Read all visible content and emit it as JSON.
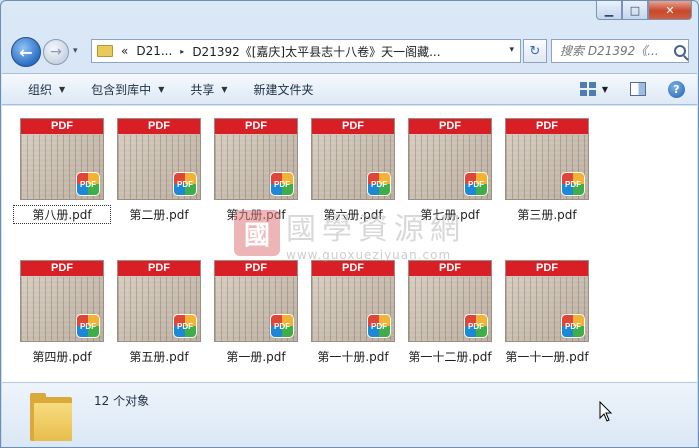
{
  "window": {
    "caption": {
      "minimize": "▁",
      "maximize": "□",
      "close": "✕"
    }
  },
  "nav": {
    "back_glyph": "←",
    "forward_glyph": "→",
    "dropdown_glyph": "▾"
  },
  "address": {
    "overflow": "«",
    "crumbs": [
      "D21...",
      "D21392《[嘉庆]太平县志十八卷》天一阁藏..."
    ],
    "separator": "▸",
    "dropdown_glyph": "▾",
    "refresh_glyph": "↻"
  },
  "search": {
    "placeholder": "搜索 D21392《..."
  },
  "toolbar": {
    "organize": "组织",
    "include_library": "包含到库中",
    "share": "共享",
    "new_folder": "新建文件夹",
    "arrow": "▼"
  },
  "files": [
    {
      "name": "第八册.pdf",
      "selected": true
    },
    {
      "name": "第二册.pdf"
    },
    {
      "name": "第九册.pdf"
    },
    {
      "name": "第六册.pdf"
    },
    {
      "name": "第七册.pdf"
    },
    {
      "name": "第三册.pdf"
    },
    {
      "name": "第四册.pdf"
    },
    {
      "name": "第五册.pdf"
    },
    {
      "name": "第一册.pdf"
    },
    {
      "name": "第一十册.pdf"
    },
    {
      "name": "第一十二册.pdf"
    },
    {
      "name": "第一十一册.pdf"
    }
  ],
  "thumb": {
    "banner": "PDF",
    "badge": "PDF"
  },
  "watermark": {
    "seal": "國",
    "name": "國學資源網",
    "url": "www.guoxueziyuan.com"
  },
  "status": {
    "count_text": "12 个对象"
  },
  "colors": {
    "pdf_red": "#d81f26",
    "window_frame": "#6e8db3",
    "close_red": "#c7482c"
  }
}
